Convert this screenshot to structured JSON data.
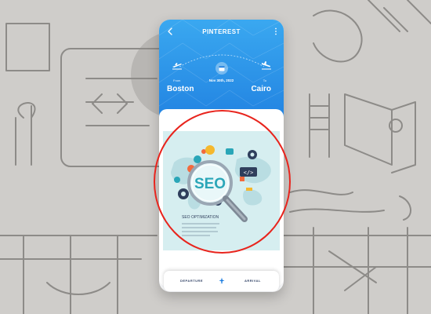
{
  "app": {
    "title": "PINTEREST"
  },
  "flight": {
    "from_label": "From",
    "from_city": "Boston",
    "to_label": "To",
    "to_city": "Cairo",
    "date": "Nov 30th, 2022"
  },
  "artwork": {
    "heading": "SEO",
    "caption": "SEO OPTIMIZATION",
    "code_tag": "</>"
  },
  "bottom_tabs": {
    "departure": "DEPARTURE",
    "arrival": "ARRIVAL"
  },
  "colors": {
    "header_top": "#3aa8f0",
    "header_bottom": "#1f7fe0",
    "highlight": "#e8241d",
    "page_bg": "#cfcdca"
  },
  "icons": {
    "back": "chevron-left-icon",
    "more": "more-vertical-icon",
    "depart": "plane-departure-icon",
    "arrive": "plane-arrival-icon",
    "calendar": "calendar-icon",
    "center_plane": "plane-icon"
  }
}
